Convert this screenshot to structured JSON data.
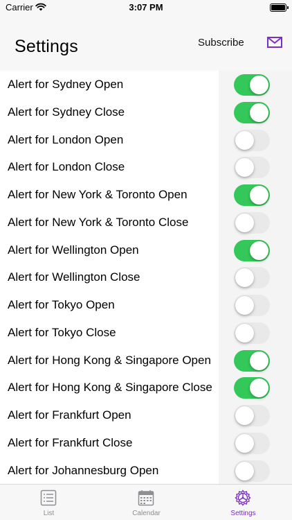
{
  "status": {
    "carrier": "Carrier",
    "time": "3:07 PM"
  },
  "header": {
    "title": "Settings",
    "subscribe_label": "Subscribe",
    "mail_icon": "mail-icon"
  },
  "colors": {
    "accent": "#7b2fc1",
    "toggle_on": "#34c759",
    "toggle_off": "#e9e9ea",
    "tab_inactive": "#8e8e93"
  },
  "alerts": [
    {
      "label": "Alert for Sydney Open",
      "on": true
    },
    {
      "label": "Alert for Sydney Close",
      "on": true
    },
    {
      "label": "Alert for London Open",
      "on": false
    },
    {
      "label": "Alert for London Close",
      "on": false
    },
    {
      "label": "Alert for New York & Toronto Open",
      "on": true
    },
    {
      "label": "Alert for New York & Toronto Close",
      "on": false
    },
    {
      "label": "Alert for Wellington Open",
      "on": true
    },
    {
      "label": "Alert for Wellington Close",
      "on": false
    },
    {
      "label": "Alert for Tokyo Open",
      "on": false
    },
    {
      "label": "Alert for Tokyo Close",
      "on": false
    },
    {
      "label": "Alert for Hong Kong & Singapore Open",
      "on": true
    },
    {
      "label": "Alert for Hong Kong & Singapore Close",
      "on": true
    },
    {
      "label": "Alert for Frankfurt Open",
      "on": false
    },
    {
      "label": "Alert for Frankfurt Close",
      "on": false
    },
    {
      "label": "Alert for Johannesburg Open",
      "on": false
    }
  ],
  "tabs": [
    {
      "label": "List",
      "icon": "list-icon",
      "active": false
    },
    {
      "label": "Calendar",
      "icon": "calendar-icon",
      "active": false
    },
    {
      "label": "Settings",
      "icon": "settings-gear-icon",
      "active": true
    }
  ]
}
